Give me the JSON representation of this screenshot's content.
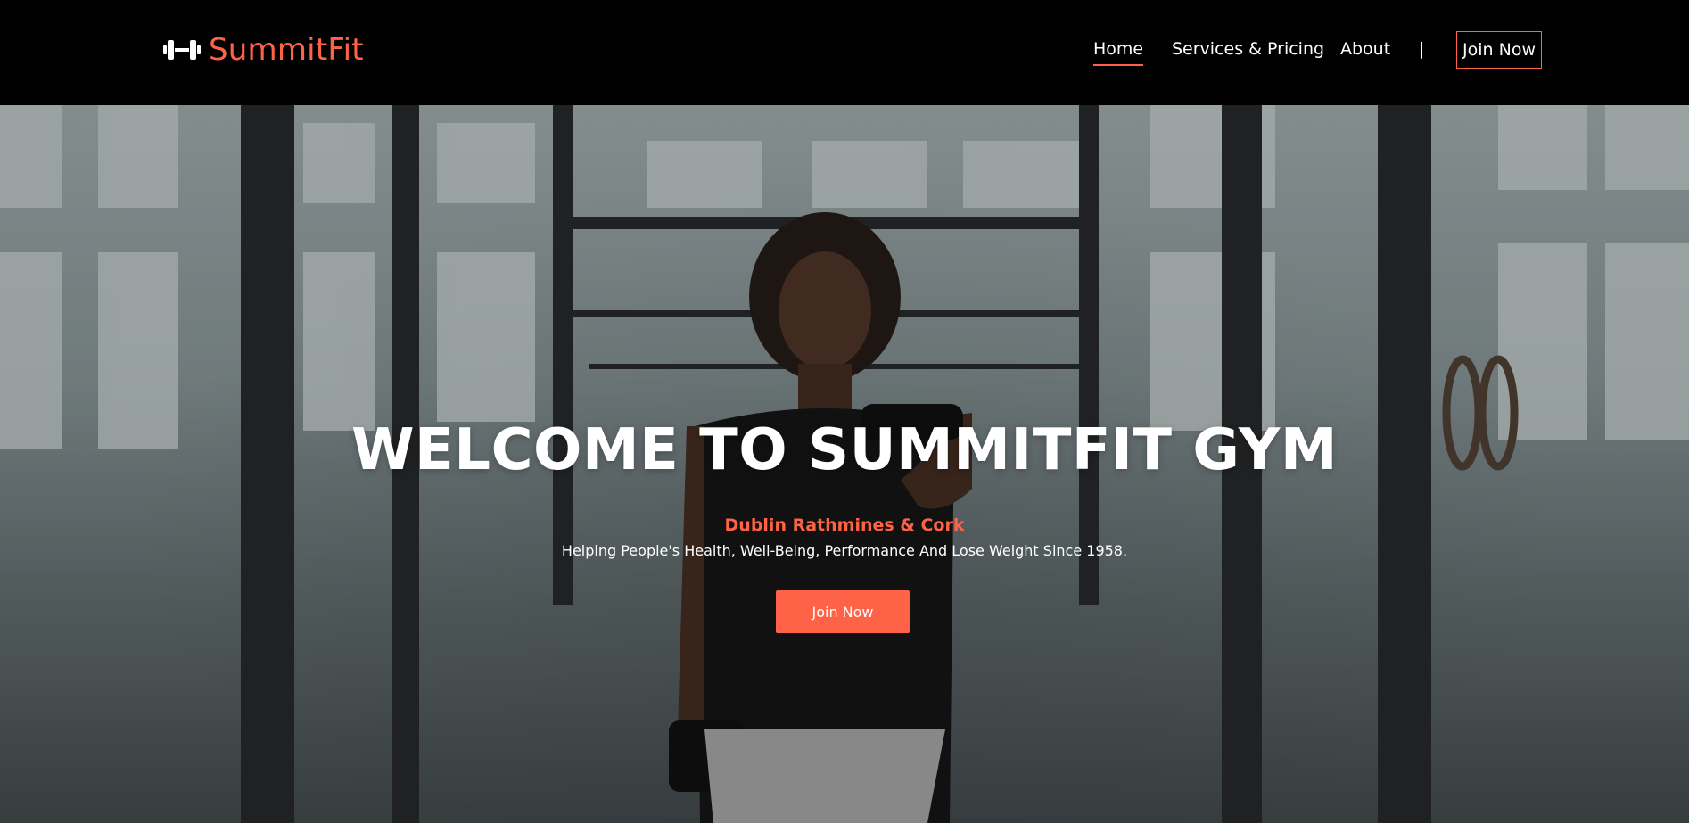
{
  "brand": {
    "name": "SummitFit",
    "icon": "dumbbell-icon",
    "color": "#ff6347"
  },
  "nav": {
    "items": [
      {
        "label": "Home",
        "active": true
      },
      {
        "label": "Services & Pricing",
        "active": false
      },
      {
        "label": "About",
        "active": false
      }
    ],
    "separator": "|",
    "join_label": "Join Now"
  },
  "hero": {
    "title": "WELCOME TO SUMMITFIT GYM",
    "location": "Dublin Rathmines & Cork",
    "tagline": "Helping People's Health, Well-Being, Performance And Lose Weight Since 1958.",
    "cta_label": "Join Now",
    "background_image": "gym-woman-dumbbell-photo"
  },
  "colors": {
    "accent": "#ff6347",
    "nav_bg": "#000000",
    "text": "#ffffff"
  }
}
